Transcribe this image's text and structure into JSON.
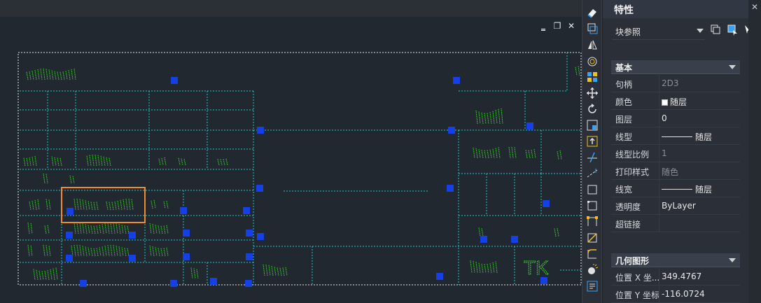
{
  "canvas": {
    "window_controls": {
      "minimize": "‗",
      "restore": "❐",
      "close": "✕"
    },
    "colors": {
      "background": "#212830",
      "frame": "#e8e8e8",
      "grid": "#21c8c8",
      "text": "#3ddc2a",
      "grip": "#1440e6",
      "highlight": "#f08a2a"
    },
    "tk_label": "TK"
  },
  "toolbar": {
    "tools": [
      "eraser-icon",
      "copy-icon",
      "mirror-icon",
      "offset-icon",
      "array-icon",
      "move-icon",
      "rotate-icon",
      "scale-icon",
      "stretch-icon",
      "trim-icon",
      "extend-icon",
      "break-icon",
      "break-at-point-icon",
      "join-icon",
      "chamfer-icon",
      "fillet-icon",
      "explode-icon",
      "properties-icon"
    ]
  },
  "properties": {
    "title": "特性",
    "close_icon": "✕",
    "object_type": "块参照",
    "sections": {
      "basic": "基本",
      "geometry": "几何图形"
    },
    "basic_rows": [
      {
        "key": "句柄",
        "value": "2D3"
      },
      {
        "key": "颜色",
        "value": "随层"
      },
      {
        "key": "图层",
        "value": "0"
      },
      {
        "key": "线型",
        "value": "随层"
      },
      {
        "key": "线型比例",
        "value": "1"
      },
      {
        "key": "打印样式",
        "value": "随色"
      },
      {
        "key": "线宽",
        "value": "随层"
      },
      {
        "key": "透明度",
        "value": "ByLayer"
      },
      {
        "key": "超链接",
        "value": ""
      }
    ],
    "geometry_rows": [
      {
        "key": "位置 X 坐...",
        "value": "349.4767"
      },
      {
        "key": "位置 Y 坐标",
        "value": "-116.0724"
      }
    ]
  }
}
